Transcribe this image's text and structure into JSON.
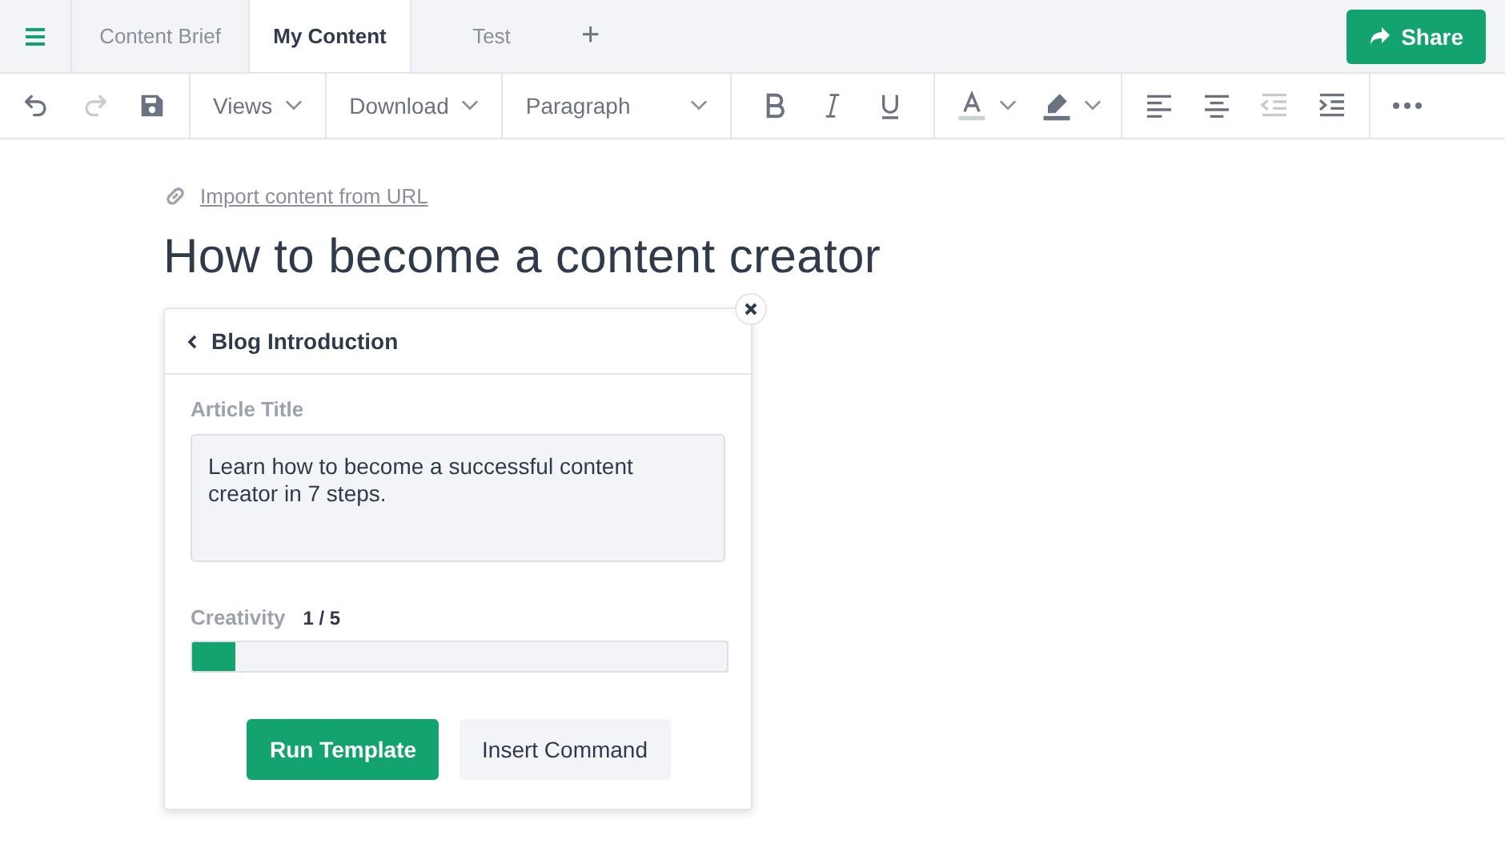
{
  "tabs": [
    {
      "label": "Content Brief",
      "selected": false
    },
    {
      "label": "My Content",
      "selected": true
    },
    {
      "label": "Test",
      "selected": false
    }
  ],
  "add_tab": "+",
  "share_button": "Share",
  "toolbar": {
    "history_buttons": [
      {
        "disabled": false
      },
      {
        "disabled": true
      },
      {
        "disabled": false
      }
    ],
    "dropdowns": [
      {
        "label": "Views"
      },
      {
        "label": "Download"
      },
      {
        "label": "Paragraph"
      }
    ],
    "format_buttons": [
      {
        "disabled": false
      },
      {
        "disabled": false
      },
      {
        "disabled": false
      }
    ],
    "align_buttons": [
      {
        "disabled": false
      },
      {
        "disabled": false
      },
      {
        "disabled": true
      },
      {
        "disabled": false
      }
    ]
  },
  "import_link": "Import content from URL",
  "document_title": "How to become a content creator",
  "panel": {
    "title": "Blog Introduction",
    "field_label": "Article Title",
    "field_value": "Learn how to become a successful content creator in 7 steps.",
    "slider_label": "Creativity",
    "slider_reading": "1 / 5",
    "level": 0.08,
    "buttons": [
      {
        "label": "Run Template",
        "kind": "primary"
      },
      {
        "label": "Insert Command",
        "kind": "secondary"
      }
    ]
  }
}
